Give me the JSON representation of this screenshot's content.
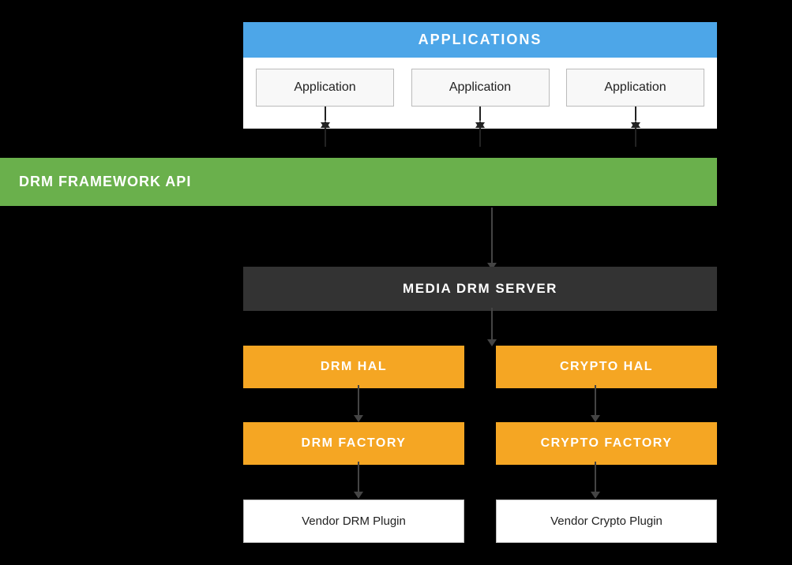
{
  "applications": {
    "header": "APPLICATIONS",
    "boxes": [
      "Application",
      "Application",
      "Application"
    ]
  },
  "drm_framework": {
    "label": "DRM FRAMEWORK API"
  },
  "media_drm_server": {
    "label": "MEDIA DRM SERVER"
  },
  "hal_row": {
    "drm_hal": "DRM HAL",
    "crypto_hal": "CRYPTO HAL"
  },
  "factory_row": {
    "drm_factory": "DRM FACTORY",
    "crypto_factory": "CRYPTO FACTORY"
  },
  "plugin_row": {
    "drm_plugin": "Vendor DRM Plugin",
    "crypto_plugin": "Vendor Crypto Plugin"
  },
  "colors": {
    "blue": "#4da6e8",
    "green": "#6ab04c",
    "dark": "#333",
    "orange": "#f5a623",
    "black": "#000",
    "white": "#fff"
  }
}
